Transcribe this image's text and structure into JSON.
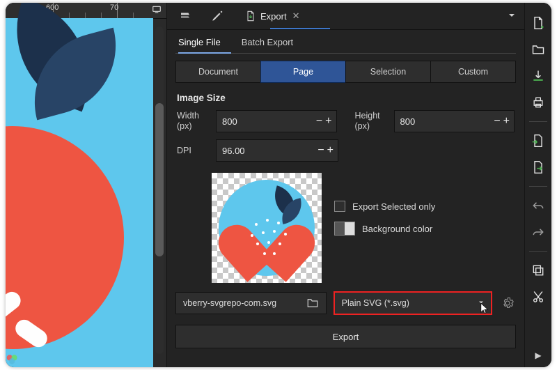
{
  "ruler": {
    "label_600": "600",
    "label_70": "70"
  },
  "topTabs": {
    "export": "Export"
  },
  "modeTabs": {
    "single": "Single File",
    "batch": "Batch Export"
  },
  "sourceTabs": {
    "document": "Document",
    "page": "Page",
    "selection": "Selection",
    "custom": "Custom"
  },
  "imageSize": {
    "heading": "Image Size",
    "widthLabel": "Width\n(px)",
    "width": "800",
    "heightLabel": "Height\n(px)",
    "height": "800",
    "dpiLabel": "DPI",
    "dpi": "96.00"
  },
  "options": {
    "exportSelected": "Export Selected only",
    "backgroundColor": "Background color"
  },
  "file": {
    "name": "vberry-svgrepo-com.svg",
    "format": "Plain SVG (*.svg)"
  },
  "exportBtn": "Export"
}
